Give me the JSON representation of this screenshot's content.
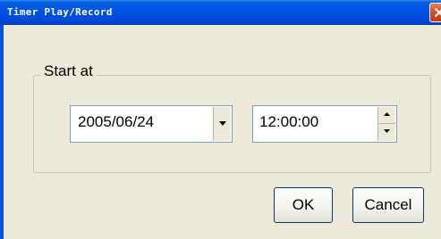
{
  "window": {
    "title": "Timer Play/Record"
  },
  "group": {
    "label": "Start at"
  },
  "date_picker": {
    "value": "2005/06/24"
  },
  "time_picker": {
    "value": "12:00:00"
  },
  "buttons": {
    "ok_label": "OK",
    "cancel_label": "Cancel"
  },
  "icons": {
    "close": "close-icon",
    "dropdown": "chevron-down-icon",
    "spin_up": "arrow-up-icon",
    "spin_down": "arrow-down-icon"
  },
  "colors": {
    "titlebar": "#0055e5",
    "close_button": "#d6491f",
    "dialog_background": "#ece9d8",
    "field_border": "#7f9db9",
    "button_border": "#003c74"
  }
}
